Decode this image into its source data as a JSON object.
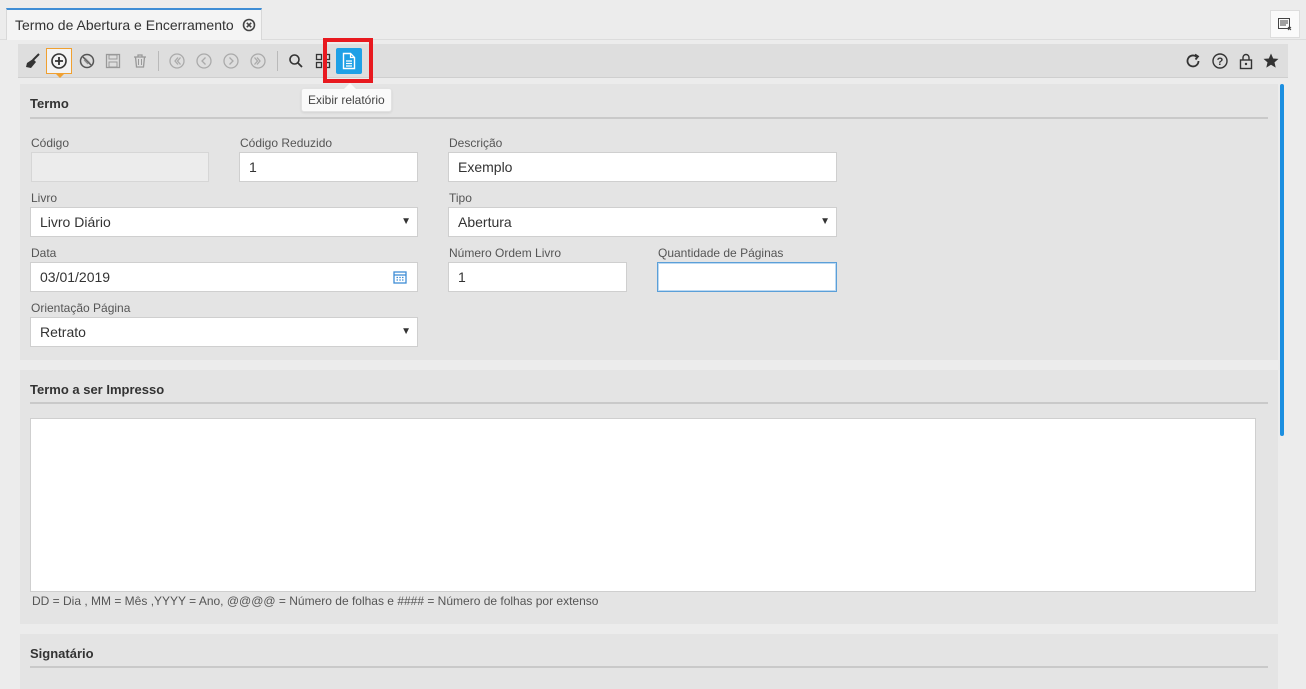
{
  "tab": {
    "title": "Termo de Abertura e Encerramento"
  },
  "tooltip": {
    "text": "Exibir relatório"
  },
  "section_termo": {
    "title": "Termo",
    "fields": {
      "codigo": {
        "label": "Código",
        "value": ""
      },
      "codigo_reduzido": {
        "label": "Código Reduzido",
        "value": "1"
      },
      "descricao": {
        "label": "Descrição",
        "value": "Exemplo"
      },
      "livro": {
        "label": "Livro",
        "value": "Livro Diário"
      },
      "tipo": {
        "label": "Tipo",
        "value": "Abertura"
      },
      "data": {
        "label": "Data",
        "value": "03/01/2019"
      },
      "numero_ordem": {
        "label": "Número Ordem Livro",
        "value": "1"
      },
      "qtd_paginas": {
        "label": "Quantidade de Páginas",
        "value": ""
      },
      "orientacao": {
        "label": "Orientação Página",
        "value": "Retrato"
      }
    }
  },
  "section_impresso": {
    "title": "Termo a ser Impresso",
    "text": "",
    "help": "DD = Dia , MM = Mês ,YYYY = Ano, @@@@ = Número de folhas e #### = Número de folhas por extenso"
  },
  "section_signatario": {
    "title": "Signatário"
  },
  "colors": {
    "accent": "#1ea0e6",
    "highlight": "#e8191f",
    "tab_border": "#3e8dd5",
    "scrollbar": "#1c8fe0"
  }
}
